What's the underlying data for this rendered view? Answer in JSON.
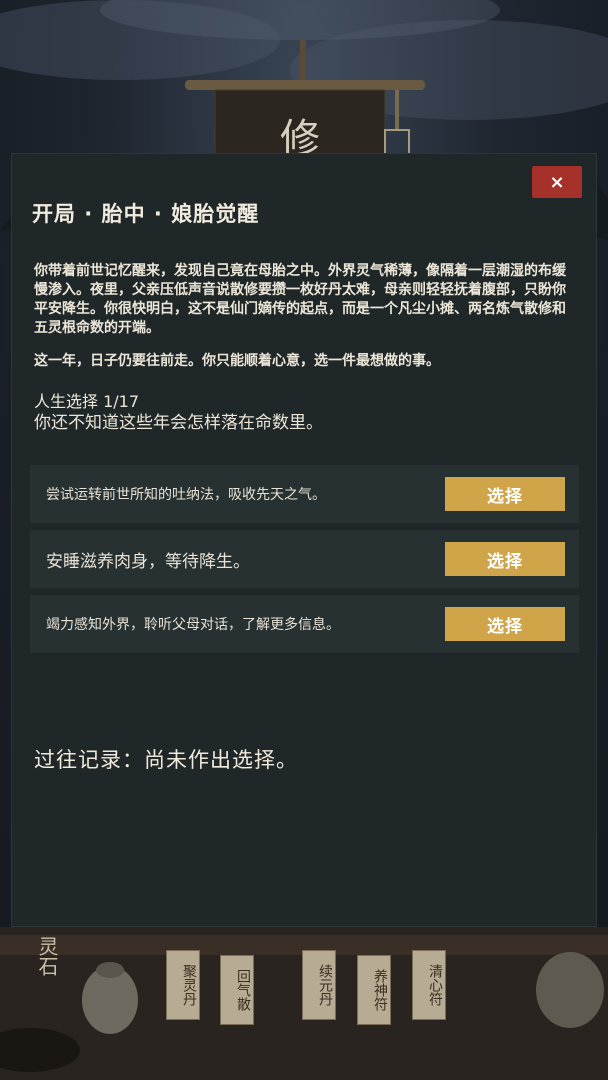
{
  "banner": {
    "glyph": "修"
  },
  "dialog": {
    "close_label": "×",
    "title": "开局 · 胎中 · 娘胎觉醒",
    "story_paragraph_1": "你带着前世记忆醒来，发现自己竟在母胎之中。外界灵气稀薄，像隔着一层潮湿的布缓慢渗入。夜里，父亲压低声音说散修要攒一枚好丹太难，母亲则轻轻抚着腹部，只盼你平安降生。你很快明白，这不是仙门嫡传的起点，而是一个凡尘小摊、两名炼气散修和五灵根命数的开端。",
    "story_paragraph_2": "这一年，日子仍要往前走。你只能顺着心意，选一件最想做的事。",
    "choice_count": "人生选择 1/17",
    "hint": "你还不知道这些年会怎样落在命数里。",
    "options": [
      {
        "text": "尝试运转前世所知的吐纳法，吸收先天之气。",
        "button": "选择"
      },
      {
        "text": "安睡滋养肉身，等待降生。",
        "button": "选择"
      },
      {
        "text": "竭力感知外界，聆听父母对话，了解更多信息。",
        "button": "选择"
      }
    ],
    "history": "过往记录：尚未作出选择。"
  },
  "background": {
    "left_sign": "灵石",
    "tags": [
      "聚灵丹",
      "回气散",
      "续元丹",
      "养神符",
      "清心符"
    ]
  },
  "colors": {
    "dialog_bg": "#1f2728",
    "option_bg": "#283132",
    "button_gold": "#d0a448",
    "close_red": "#a6302a"
  }
}
